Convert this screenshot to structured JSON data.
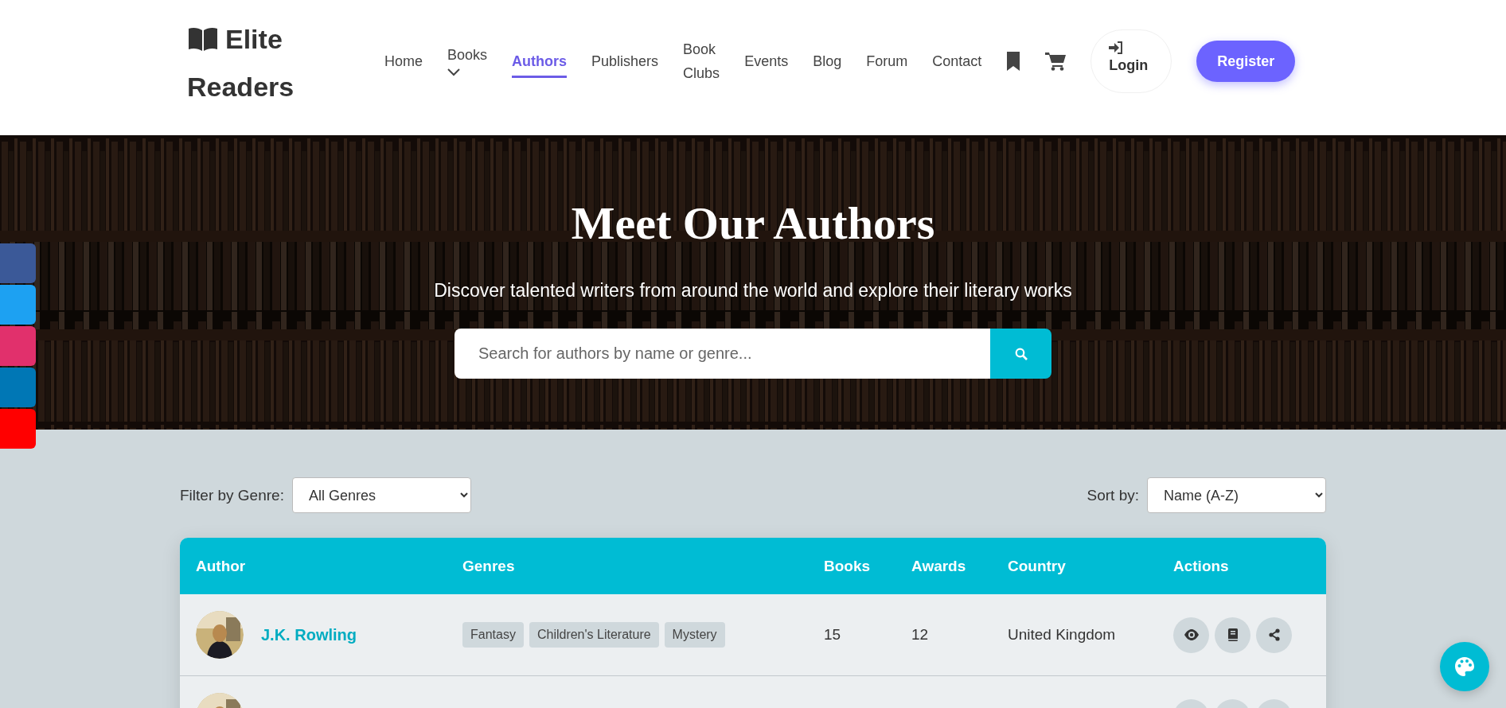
{
  "brand": {
    "name": "Elite Readers"
  },
  "nav": [
    {
      "label": "Home",
      "selected": false,
      "dropdown": false
    },
    {
      "label": "Books",
      "selected": false,
      "dropdown": true
    },
    {
      "label": "Authors",
      "selected": true,
      "dropdown": false
    },
    {
      "label": "Publishers",
      "selected": false,
      "dropdown": false
    },
    {
      "label": "Book Clubs",
      "selected": false,
      "dropdown": false
    },
    {
      "label": "Events",
      "selected": false,
      "dropdown": false
    },
    {
      "label": "Blog",
      "selected": false,
      "dropdown": false
    },
    {
      "label": "Forum",
      "selected": false,
      "dropdown": false
    },
    {
      "label": "Contact",
      "selected": false,
      "dropdown": false
    }
  ],
  "login": {
    "label": "Login"
  },
  "register": {
    "label": "Register"
  },
  "social": [
    {
      "color": "#3b5998"
    },
    {
      "color": "#1da1f2"
    },
    {
      "color": "#e1306c"
    },
    {
      "color": "#0077b5"
    },
    {
      "color": "#ff0000"
    }
  ],
  "hero": {
    "title": "Meet Our Authors",
    "subtitle": "Discover talented writers from around the world and explore their literary works",
    "search": {
      "placeholder": "Search for authors by name or genre..."
    }
  },
  "filter": {
    "label": "Filter by Genre:",
    "value": "All Genres"
  },
  "sort": {
    "label": "Sort by:",
    "value": "Name (A-Z)"
  },
  "table": {
    "columns": [
      "Author",
      "Genres",
      "Books",
      "Awards",
      "Country",
      "Actions"
    ],
    "rows": [
      {
        "name": "J.K. Rowling",
        "genres": [
          "Fantasy",
          "Children's Literature",
          "Mystery"
        ],
        "books": "15",
        "awards": "12",
        "country": "United Kingdom"
      },
      {}
    ]
  }
}
